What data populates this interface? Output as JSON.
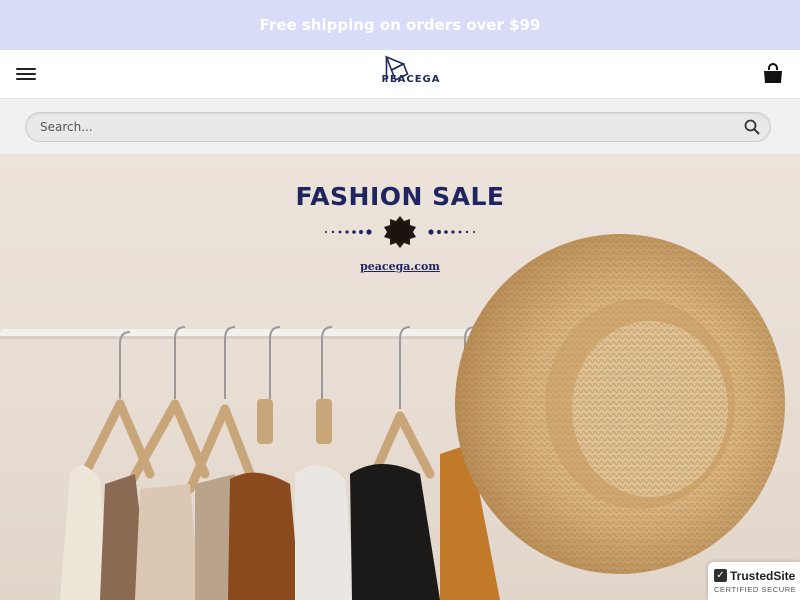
{
  "promo": {
    "text": "Free shipping on orders over $99"
  },
  "header": {
    "logo_text": "PEACEGA",
    "menu_icon": "hamburger-menu-icon",
    "cart_icon": "shopping-bag-icon"
  },
  "search": {
    "placeholder": "Search..."
  },
  "hero": {
    "title": "FASHION SALE",
    "url": "peacega.com"
  },
  "trust_badge": {
    "name": "TrustedSite",
    "subtitle": "CERTIFIED SECURE"
  },
  "colors": {
    "promo_bg": "#d9dcf7",
    "brand_navy": "#1f2560",
    "hero_bg": "#ece3db"
  }
}
